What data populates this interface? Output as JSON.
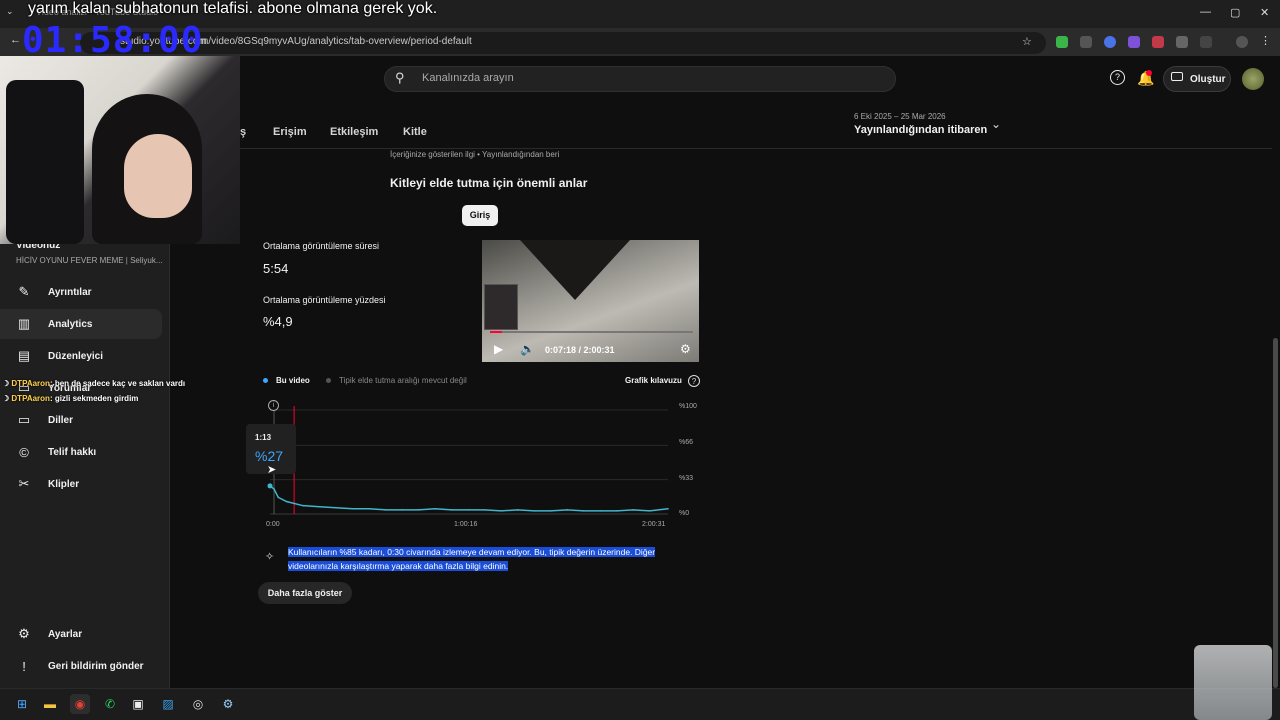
{
  "overlay": {
    "caption": "yarım kalan subhatonun telafisi. abone olmana gerek yok.",
    "timer": "01:58:00"
  },
  "browser": {
    "tab_title": "Video analizi - YouTube Studio",
    "url_host": "studio.youtube.com",
    "url": "m/video/8GSq9myvAUg/analytics/tab-overview/period-default"
  },
  "header": {
    "search_placeholder": "Kanalınızda arayın",
    "create_label": "Oluştur",
    "icons": [
      "help-icon",
      "bell-icon",
      "create-video-icon"
    ]
  },
  "tabs": [
    "ş",
    "Erişim",
    "Etkileşim",
    "Kitle"
  ],
  "period": {
    "range": "6 Eki 2025 – 25 Mar 2026",
    "label": "Yayınlandığından itibaren"
  },
  "sidebar": {
    "video_heading": "Videonuz",
    "video_title": "HİCİV OYUNU FEVER MEME | Seliyuk...",
    "items": [
      {
        "label": "Ayrıntılar",
        "icon": "pencil-icon",
        "glyph": "✎"
      },
      {
        "label": "Analytics",
        "icon": "analytics-icon",
        "glyph": "▥"
      },
      {
        "label": "Düzenleyici",
        "icon": "editor-icon",
        "glyph": "▤"
      },
      {
        "label": "Yorumlar",
        "icon": "comments-icon",
        "glyph": "▭"
      },
      {
        "label": "Diller",
        "icon": "subtitles-icon",
        "glyph": "▭"
      },
      {
        "label": "Telif hakkı",
        "icon": "copyright-icon",
        "glyph": "©"
      },
      {
        "label": "Klipler",
        "icon": "scissors-icon",
        "glyph": "✂"
      }
    ],
    "bottom": [
      {
        "label": "Ayarlar",
        "icon": "gear-icon",
        "glyph": "⚙"
      },
      {
        "label": "Geri bildirim gönder",
        "icon": "feedback-icon",
        "glyph": "!"
      }
    ]
  },
  "chat": [
    {
      "user": "DTPAaron",
      "text": ": ben de sadece kaç ve saklan vardı"
    },
    {
      "user": "DTPAaron",
      "text": ": gizli sekmeden girdim"
    }
  ],
  "main": {
    "section_subtitle": "İçeriğinize gösterilen ilgi • Yayınlandığından beri",
    "section_title": "Kitleyi elde tutma için önemli anlar",
    "intro_button": "Giriş",
    "metrics": [
      {
        "label": "Ortalama görüntüleme süresi",
        "value": "5:54"
      },
      {
        "label": "Ortalama görüntüleme yüzdesi",
        "value": "%4,9"
      }
    ],
    "player_time": "0:07:18 / 2:00:31",
    "player_progress": 0.061,
    "legend_this": "Bu video",
    "legend_typical": "Tipik elde tutma aralığı mevcut değil",
    "chart_guide": "Grafik kılavuzu",
    "tooltip_time": "1:13",
    "tooltip_value": "%27",
    "insight": "Kullanıcıların %85 kadarı, 0:30 civarında izlemeye devam ediyor. Bu, tipik değerin üzerinde. Diğer videolarınızla karşılaştırma yaparak daha fazla bilgi edinin.",
    "show_more": "Daha fazla göster"
  },
  "colors": {
    "accent": "#3ea6ff",
    "line": "#3fb6c9",
    "playhead": "#ff0033",
    "highlight": "#1a4ed8"
  },
  "chart_data": {
    "type": "line",
    "xlabel": "",
    "ylabel": "",
    "x_ticks": [
      "0:00",
      "1:00:16",
      "2:00:31"
    ],
    "y_ticks": [
      "%100",
      "%66",
      "%33",
      "%0"
    ],
    "ylim": [
      0,
      100
    ],
    "xlim_seconds": [
      0,
      7231
    ],
    "series": [
      {
        "name": "Bu video",
        "x_seconds": [
          0,
          73,
          150,
          300,
          600,
          900,
          1200,
          1500,
          1800,
          2100,
          2400,
          2700,
          3000,
          3300,
          3616,
          3900,
          4200,
          4500,
          4800,
          5100,
          5400,
          5700,
          6000,
          6300,
          6600,
          6900,
          7231
        ],
        "values": [
          27,
          24,
          16,
          12,
          8,
          7,
          6,
          5,
          5,
          4,
          4,
          4,
          5,
          4,
          4,
          4,
          3,
          4,
          3,
          3,
          4,
          3,
          3,
          3,
          4,
          3,
          5
        ]
      }
    ],
    "playhead_seconds": 438,
    "grid": true
  }
}
